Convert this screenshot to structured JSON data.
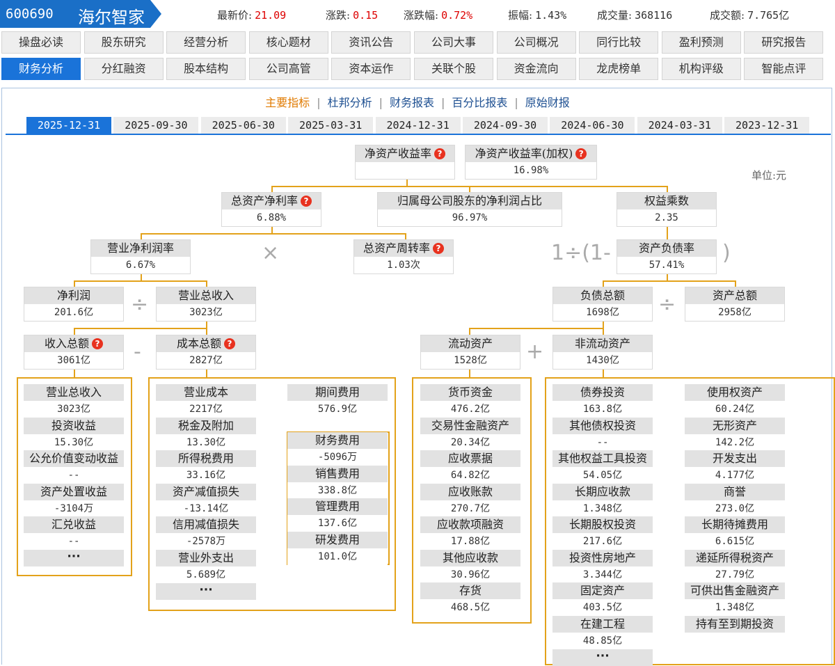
{
  "stock": {
    "code": "600690",
    "name": "海尔智家"
  },
  "quote": [
    {
      "label": "最新价:",
      "value": "21.09",
      "red": true
    },
    {
      "label": "涨跌:",
      "value": "0.15",
      "red": true
    },
    {
      "label": "涨跌幅:",
      "value": "0.72%",
      "red": true
    },
    {
      "label": "振幅:",
      "value": "1.43%",
      "red": false
    },
    {
      "label": "成交量:",
      "value": "368116",
      "red": false
    },
    {
      "label": "成交额:",
      "value": "7.765亿",
      "red": false
    }
  ],
  "nav_row1": [
    "操盘必读",
    "股东研究",
    "经营分析",
    "核心题材",
    "资讯公告",
    "公司大事",
    "公司概况",
    "同行比较",
    "盈利预测",
    "研究报告"
  ],
  "nav_row2": [
    "财务分析",
    "分红融资",
    "股本结构",
    "公司高管",
    "资本运作",
    "关联个股",
    "资金流向",
    "龙虎榜单",
    "机构评级",
    "智能点评"
  ],
  "active_nav": "财务分析",
  "subnav": [
    "主要指标",
    "杜邦分析",
    "财务报表",
    "百分比报表",
    "原始财报"
  ],
  "subnav_active": "主要指标",
  "dates": [
    "2025-12-31",
    "2025-09-30",
    "2025-06-30",
    "2025-03-31",
    "2024-12-31",
    "2024-09-30",
    "2024-06-30",
    "2024-03-31",
    "2023-12-31"
  ],
  "active_date": "2025-12-31",
  "unit": "单位:元",
  "colors": {
    "accent": "#1a73d9",
    "line": "#e3a21a",
    "help": "#e8321f",
    "price_up": "#dd0000"
  },
  "nodes": {
    "roe": {
      "label": "净资产收益率",
      "value": "",
      "help": true
    },
    "roe_weighted": {
      "label": "净资产收益率(加权)",
      "value": "16.98%",
      "help": true
    },
    "roa": {
      "label": "总资产净利率",
      "value": "6.88%",
      "help": true
    },
    "parent_share": {
      "label": "归属母公司股东的净利润占比",
      "value": "96.97%",
      "help": false
    },
    "equity_mult": {
      "label": "权益乘数",
      "value": "2.35",
      "help": false
    },
    "net_margin": {
      "label": "营业净利润率",
      "value": "6.67%",
      "help": false
    },
    "asset_turnover": {
      "label": "总资产周转率",
      "value": "1.03次",
      "help": true
    },
    "debt_ratio": {
      "label": "资产负债率",
      "value": "57.41%",
      "help": false
    },
    "net_profit": {
      "label": "净利润",
      "value": "201.6亿",
      "help": false
    },
    "revenue": {
      "label": "营业总收入",
      "value": "3023亿",
      "help": false
    },
    "total_liab": {
      "label": "负债总额",
      "value": "1698亿",
      "help": false
    },
    "total_assets": {
      "label": "资产总额",
      "value": "2958亿",
      "help": false
    },
    "total_income": {
      "label": "收入总额",
      "value": "3061亿",
      "help": true
    },
    "total_cost": {
      "label": "成本总额",
      "value": "2827亿",
      "help": true
    },
    "current_assets": {
      "label": "流动资产",
      "value": "1528亿",
      "help": false
    },
    "noncurrent_assets": {
      "label": "非流动资产",
      "value": "1430亿",
      "help": false
    }
  },
  "ops": {
    "times": "×",
    "divide": "÷",
    "minus": "-",
    "plus": "+",
    "one_div": "1÷(1-",
    "close_paren": ")"
  },
  "income_items": [
    {
      "label": "营业总收入",
      "value": "3023亿"
    },
    {
      "label": "投资收益",
      "value": "15.30亿"
    },
    {
      "label": "公允价值变动收益",
      "value": "--"
    },
    {
      "label": "资产处置收益",
      "value": "-3104万"
    },
    {
      "label": "汇兑收益",
      "value": "--"
    }
  ],
  "cost_items": [
    {
      "label": "营业成本",
      "value": "2217亿"
    },
    {
      "label": "税金及附加",
      "value": "13.30亿"
    },
    {
      "label": "所得税费用",
      "value": "33.16亿"
    },
    {
      "label": "资产减值损失",
      "value": "-13.14亿"
    },
    {
      "label": "信用减值损失",
      "value": "-2578万"
    },
    {
      "label": "营业外支出",
      "value": "5.689亿"
    }
  ],
  "period_expense": {
    "label": "期间费用",
    "value": "576.9亿"
  },
  "period_items": [
    {
      "label": "财务费用",
      "value": "-5096万"
    },
    {
      "label": "销售费用",
      "value": "338.8亿"
    },
    {
      "label": "管理费用",
      "value": "137.6亿"
    },
    {
      "label": "研发费用",
      "value": "101.0亿"
    }
  ],
  "current_items": [
    {
      "label": "货币资金",
      "value": "476.2亿"
    },
    {
      "label": "交易性金融资产",
      "value": "20.34亿"
    },
    {
      "label": "应收票据",
      "value": "64.82亿"
    },
    {
      "label": "应收账款",
      "value": "270.7亿"
    },
    {
      "label": "应收款项融资",
      "value": "17.88亿"
    },
    {
      "label": "其他应收款",
      "value": "30.96亿"
    },
    {
      "label": "存货",
      "value": "468.5亿"
    }
  ],
  "noncurrent_left": [
    {
      "label": "债券投资",
      "value": "163.8亿"
    },
    {
      "label": "其他债权投资",
      "value": "--"
    },
    {
      "label": "其他权益工具投资",
      "value": "54.05亿"
    },
    {
      "label": "长期应收款",
      "value": "1.348亿"
    },
    {
      "label": "长期股权投资",
      "value": "217.6亿"
    },
    {
      "label": "投资性房地产",
      "value": "3.344亿"
    },
    {
      "label": "固定资产",
      "value": "403.5亿"
    },
    {
      "label": "在建工程",
      "value": "48.85亿"
    }
  ],
  "noncurrent_right": [
    {
      "label": "使用权资产",
      "value": "60.24亿"
    },
    {
      "label": "无形资产",
      "value": "142.2亿"
    },
    {
      "label": "开发支出",
      "value": "4.177亿"
    },
    {
      "label": "商誉",
      "value": "273.0亿"
    },
    {
      "label": "长期待摊费用",
      "value": "6.615亿"
    },
    {
      "label": "递延所得税资产",
      "value": "27.79亿"
    },
    {
      "label": "可供出售金融资产",
      "value": "1.348亿"
    },
    {
      "label": "持有至到期投资",
      "value": ""
    }
  ],
  "ellipsis": "···"
}
